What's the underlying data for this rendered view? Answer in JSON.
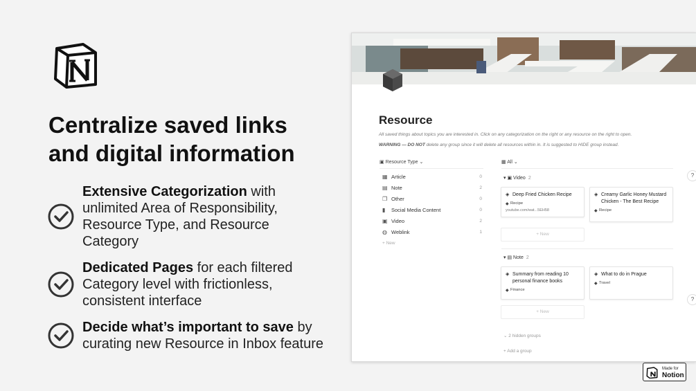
{
  "headline": "Centralize saved links and digital information",
  "features": [
    {
      "bold": "Extensive Categorization",
      "text": " with unlimited Area of Responsibility, Resource Type, and Resource Category"
    },
    {
      "bold": "Dedicated Pages",
      "text": " for each filtered Category level with frictionless, consistent interface"
    },
    {
      "bold": "Decide what’s important to save",
      "text": " by curating new Resource in Inbox feature"
    }
  ],
  "notion": {
    "page_title": "Resource",
    "description": "All saved things about topics you are interested in. Click on any categorization on the right or any resource on the right to open.",
    "warning_bold": "WARNING — DO NOT",
    "warning_text": " delete any group since it will delete all resources within in. It is suggested to HIDE group instead.",
    "sidebar": {
      "header": "Resource Type",
      "items": [
        {
          "label": "Article",
          "count": "0",
          "icon": "table-icon"
        },
        {
          "label": "Note",
          "count": "2",
          "icon": "note-icon"
        },
        {
          "label": "Other",
          "count": "0",
          "icon": "copy-icon"
        },
        {
          "label": "Social Media Content",
          "count": "0",
          "icon": "phone-icon"
        },
        {
          "label": "Video",
          "count": "2",
          "icon": "video-icon"
        },
        {
          "label": "Weblink",
          "count": "1",
          "icon": "globe-icon"
        }
      ],
      "new_label": "+ New"
    },
    "board": {
      "view_label": "All",
      "groups": [
        {
          "name": "Video",
          "count": "2",
          "cards": [
            {
              "title": "Deep Fried Chicken Recipe",
              "tag": "Recipe",
              "link": "youtube.com/wat...5EH58"
            },
            {
              "title": "Creamy Garlic Honey Mustard Chicken - The Best Recipe",
              "tag": "Recipe",
              "link": ""
            }
          ]
        },
        {
          "name": "Note",
          "count": "2",
          "cards": [
            {
              "title": "Summary from reading 10 personal finance books",
              "tag": "Finance",
              "link": ""
            },
            {
              "title": "What to do in Prague",
              "tag": "Travel",
              "link": ""
            }
          ]
        }
      ],
      "new_label": "+ New",
      "hidden_groups": "2 hidden groups",
      "add_group": "+ Add a group"
    },
    "help_label": "?"
  },
  "badge": {
    "small": "Made for",
    "big": "Notion"
  },
  "colors": {
    "background": "#f3f3f3",
    "text": "#111111"
  }
}
